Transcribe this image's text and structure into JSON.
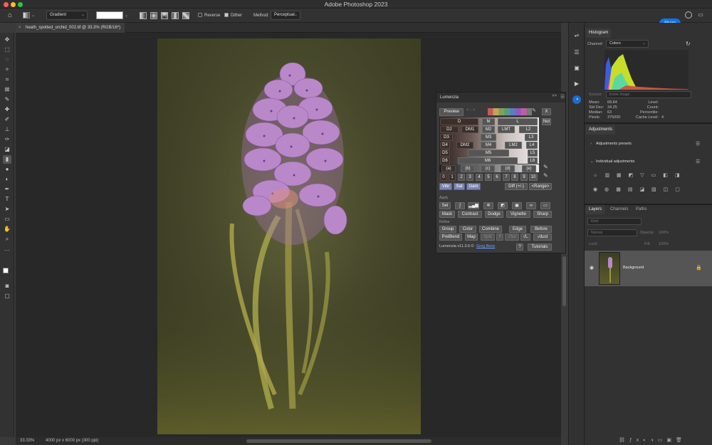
{
  "window": {
    "title": "Adobe Photoshop 2023",
    "share_label": "Share"
  },
  "options_bar": {
    "tool_preset": "Gradient",
    "reverse_label": "Reverse",
    "dither_label": "Dither",
    "method_label": "Method:",
    "method_value": "Perceptual"
  },
  "document": {
    "tab_title": "heath_spotted_orchid_002.tif @ 33.3% (RGB/16*)",
    "zoom": "33.33%",
    "size_info": "4000 px x 6000 px (300 ppi)"
  },
  "histogram": {
    "tab": "Histogram",
    "channel_label": "Channel:",
    "channel_value": "Colors",
    "source_label": "Source:",
    "source_value": "Entire Image",
    "stats_left": [
      {
        "label": "Mean:",
        "value": "68.84"
      },
      {
        "label": "Std Dev:",
        "value": "34.25"
      },
      {
        "label": "Median:",
        "value": "63"
      },
      {
        "label": "Pixels:",
        "value": "375000"
      }
    ],
    "stats_right": [
      {
        "label": "Level:",
        "value": ""
      },
      {
        "label": "Count:",
        "value": ""
      },
      {
        "label": "Percentile:",
        "value": ""
      },
      {
        "label": "Cache Level:",
        "value": "4"
      }
    ]
  },
  "adjustments": {
    "tab": "Adjustments",
    "presets_label": "Adjustments presets",
    "individual_label": "Individual adjustments"
  },
  "layers": {
    "tabs": [
      "Layers",
      "Channels",
      "Paths"
    ],
    "kind_placeholder": "Kind",
    "blend_mode": "Normal",
    "opacity_label": "Opacity:",
    "opacity_value": "100%",
    "lock_label": "Lock:",
    "fill_label": "Fill:",
    "fill_value": "100%",
    "layer_name": "Background"
  },
  "lumenzia": {
    "title": "Lumenzia",
    "preview_label": "Preview",
    "x_label": "X",
    "not_label": "Not",
    "rows": [
      [
        "D",
        "M",
        "L"
      ],
      [
        "D2",
        "DM1",
        "M2",
        "LMT",
        "L2"
      ],
      [
        "D3",
        "M3",
        "L3"
      ],
      [
        "D4",
        "DM2",
        "M4",
        "LM2",
        "L4"
      ],
      [
        "D5",
        "M5",
        "L5"
      ],
      [
        "D6",
        "M6",
        "L6"
      ]
    ],
    "zone_row": [
      "(a)",
      "(b)",
      "(c)",
      "(d)",
      "(e)"
    ],
    "numbers": [
      "0",
      "1",
      "2",
      "3",
      "4",
      "5",
      "6",
      "7",
      "8",
      "9",
      "10"
    ],
    "vibr_label": "Vibr",
    "sat_label": "Sat",
    "gam_label": "Gam",
    "diff_label": "Diff (+/-)",
    "range_label": "<Range>",
    "apply_label": "Apply",
    "sel_label": "Sel",
    "apply_row2": [
      "Mask",
      "Contrast",
      "Dodge",
      "Vignette",
      "Sharp"
    ],
    "refine_label": "Refine",
    "refine_row1": [
      "Group",
      "Color",
      "Combine",
      "Edge",
      "Before"
    ],
    "refine_row2": [
      "PreBlend",
      "Map",
      "Split",
      "If",
      "√Sel",
      "√L",
      "√dust"
    ],
    "version": "Lumenzia v11.3.6 ©",
    "author": "Greg Benz",
    "help_label": "?",
    "tutorials_label": "Tutorials"
  },
  "colors": {
    "accent": "#1473e6",
    "panel_bg": "#323232",
    "canvas_bg": "#282828",
    "flower": "#b986c8",
    "stem": "#9aa048"
  }
}
